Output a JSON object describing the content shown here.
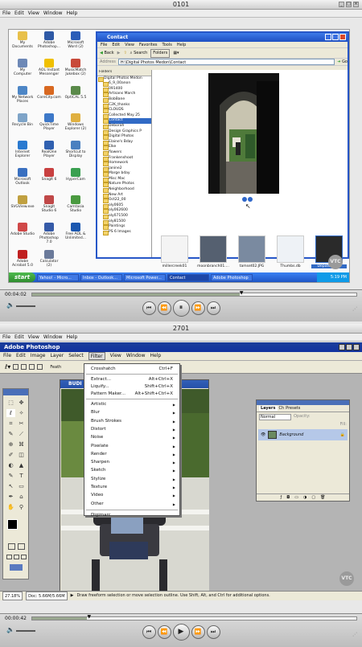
{
  "top_player": {
    "title": "0101",
    "menu": [
      "File",
      "Edit",
      "View",
      "Window",
      "Help"
    ],
    "time": "00:04:02",
    "buttons": [
      "⏮",
      "⏪",
      "⏸",
      "⏩",
      "⏭"
    ]
  },
  "desktop": {
    "icons": [
      {
        "label": "My Documents",
        "color": "#e8c04a"
      },
      {
        "label": "Adobe Photoshop...",
        "color": "#2e59a6"
      },
      {
        "label": "Microsoft Word (2)",
        "color": "#2b5db8"
      },
      {
        "label": "My Computer",
        "color": "#6d88b6"
      },
      {
        "label": "AOL Instant Messenger",
        "color": "#f0c000"
      },
      {
        "label": "MusicMatch Jukebox (2)",
        "color": "#c84a3a"
      },
      {
        "label": "My Network Places",
        "color": "#4d86c6"
      },
      {
        "label": "CoreCity.com",
        "color": "#d86820"
      },
      {
        "label": "OptiCAL 5.5",
        "color": "#5a8a4a"
      },
      {
        "label": "Recycle Bin",
        "color": "#7ea4c8"
      },
      {
        "label": "QuickTime Player",
        "color": "#3d78c8"
      },
      {
        "label": "Windows Explorer (2)",
        "color": "#e0b040"
      },
      {
        "label": "Internet Explorer",
        "color": "#2a7ad0"
      },
      {
        "label": "RealOne Player",
        "color": "#3060b0"
      },
      {
        "label": "Shortcut to Display",
        "color": "#4a80c0"
      },
      {
        "label": "Microsoft Outlook",
        "color": "#3a70c0"
      },
      {
        "label": "SnagIt 6",
        "color": "#c84040"
      },
      {
        "label": "HyperCam",
        "color": "#3aa050"
      },
      {
        "label": "SVGView.exe",
        "color": "#c0a040"
      },
      {
        "label": "SnagIt Studio 6",
        "color": "#c04848"
      },
      {
        "label": "Camtasia Studio",
        "color": "#4a9a40"
      },
      {
        "label": "Adobe Studio",
        "color": "#d04848"
      },
      {
        "label": "Adobe Photoshop 7.0",
        "color": "#355aa8"
      },
      {
        "label": "Free AOL & Unlimited...",
        "color": "#1c58b0"
      },
      {
        "label": "Adobe Acrobat 5.0",
        "color": "#c02020"
      },
      {
        "label": "Calculator (2)",
        "color": "#6a7a9a"
      }
    ],
    "explorer": {
      "title": "Contact",
      "menu": [
        "File",
        "Edit",
        "View",
        "Favorites",
        "Tools",
        "Help"
      ],
      "toolbar": {
        "back": "Back",
        "search": "Search",
        "folders": "Folders"
      },
      "address_label": "Address",
      "address": "H:\\Digital Photos Medon\\Contact",
      "go": "Go",
      "folders_header": "Folders",
      "folders": [
        "Digital Photos Medon",
        "6_9_00anon",
        "091400",
        "Artisans March",
        "BobBane",
        "C2K_thanks",
        "CLOUDS",
        "Collected May 25",
        "Contact",
        "Deborah",
        "Design Graphics P",
        "Digital Photos",
        "Elaine's Bday",
        "Elke",
        "flowers",
        "Frankenshoot",
        "Homework",
        "Janine2",
        "Marge bday",
        "Misc Mac",
        "Nature Photos",
        "Neighborhood",
        "New Art",
        "Oct22_00",
        "oly0605",
        "oly062600",
        "oly071500",
        "oly81500",
        "Paintings",
        "PS 6 Images"
      ],
      "selected_folder": "Contact",
      "thumbs": [
        "millercreek01",
        "moonbranch01....",
        "tamset02.JPG",
        "Thumbs.db",
        "Depot03.M..."
      ]
    },
    "taskbar": {
      "start": "start",
      "items": [
        "Yahoo! - Micro...",
        "Inbox - Outlook...",
        "Microsoft Power...",
        "Contact",
        "Adobe Photoshop"
      ],
      "active": "Contact",
      "clock": "5:19 PM"
    }
  },
  "bottom_player": {
    "title": "2701",
    "menu": [
      "File",
      "Edit",
      "View",
      "Window",
      "Help"
    ],
    "time": "00:00:42",
    "buttons": [
      "⏮",
      "⏪",
      "▶",
      "⏩",
      "⏭"
    ]
  },
  "photoshop": {
    "title": "Adobe Photoshop",
    "menu": [
      "File",
      "Edit",
      "Image",
      "Layer",
      "Select",
      "Filter",
      "View",
      "Window",
      "Help"
    ],
    "open_menu": "Filter",
    "option_label": "Feath",
    "doc_title": "BUDI",
    "filter_items": [
      {
        "label": "Crosshatch",
        "shortcut": "Ctrl+F"
      },
      {
        "label": "Extract...",
        "shortcut": "Alt+Ctrl+X"
      },
      {
        "label": "Liquify...",
        "shortcut": "Shift+Ctrl+X"
      },
      {
        "label": "Pattern Maker...",
        "shortcut": "Alt+Shift+Ctrl+X"
      },
      {
        "label": "Artistic"
      },
      {
        "label": "Blur"
      },
      {
        "label": "Brush Strokes"
      },
      {
        "label": "Distort"
      },
      {
        "label": "Noise"
      },
      {
        "label": "Pixelate"
      },
      {
        "label": "Render"
      },
      {
        "label": "Sharpen"
      },
      {
        "label": "Sketch"
      },
      {
        "label": "Stylize"
      },
      {
        "label": "Texture"
      },
      {
        "label": "Video"
      },
      {
        "label": "Other"
      },
      {
        "label": "Digimarc"
      }
    ],
    "layers": {
      "tabs": [
        "Layers",
        "Ch",
        "Presets"
      ],
      "blend": "Normal",
      "opacity_label": "Opacity:",
      "fill_label": "Fill:",
      "layer_name": "Background"
    },
    "status": {
      "zoom": "27.18%",
      "doc": "Doc: 5.66M/5.66M",
      "hint": "Draw freeform selection or move selection outline. Use Shift, Alt, and Ctrl for additional options."
    }
  },
  "watermark": "VTC"
}
